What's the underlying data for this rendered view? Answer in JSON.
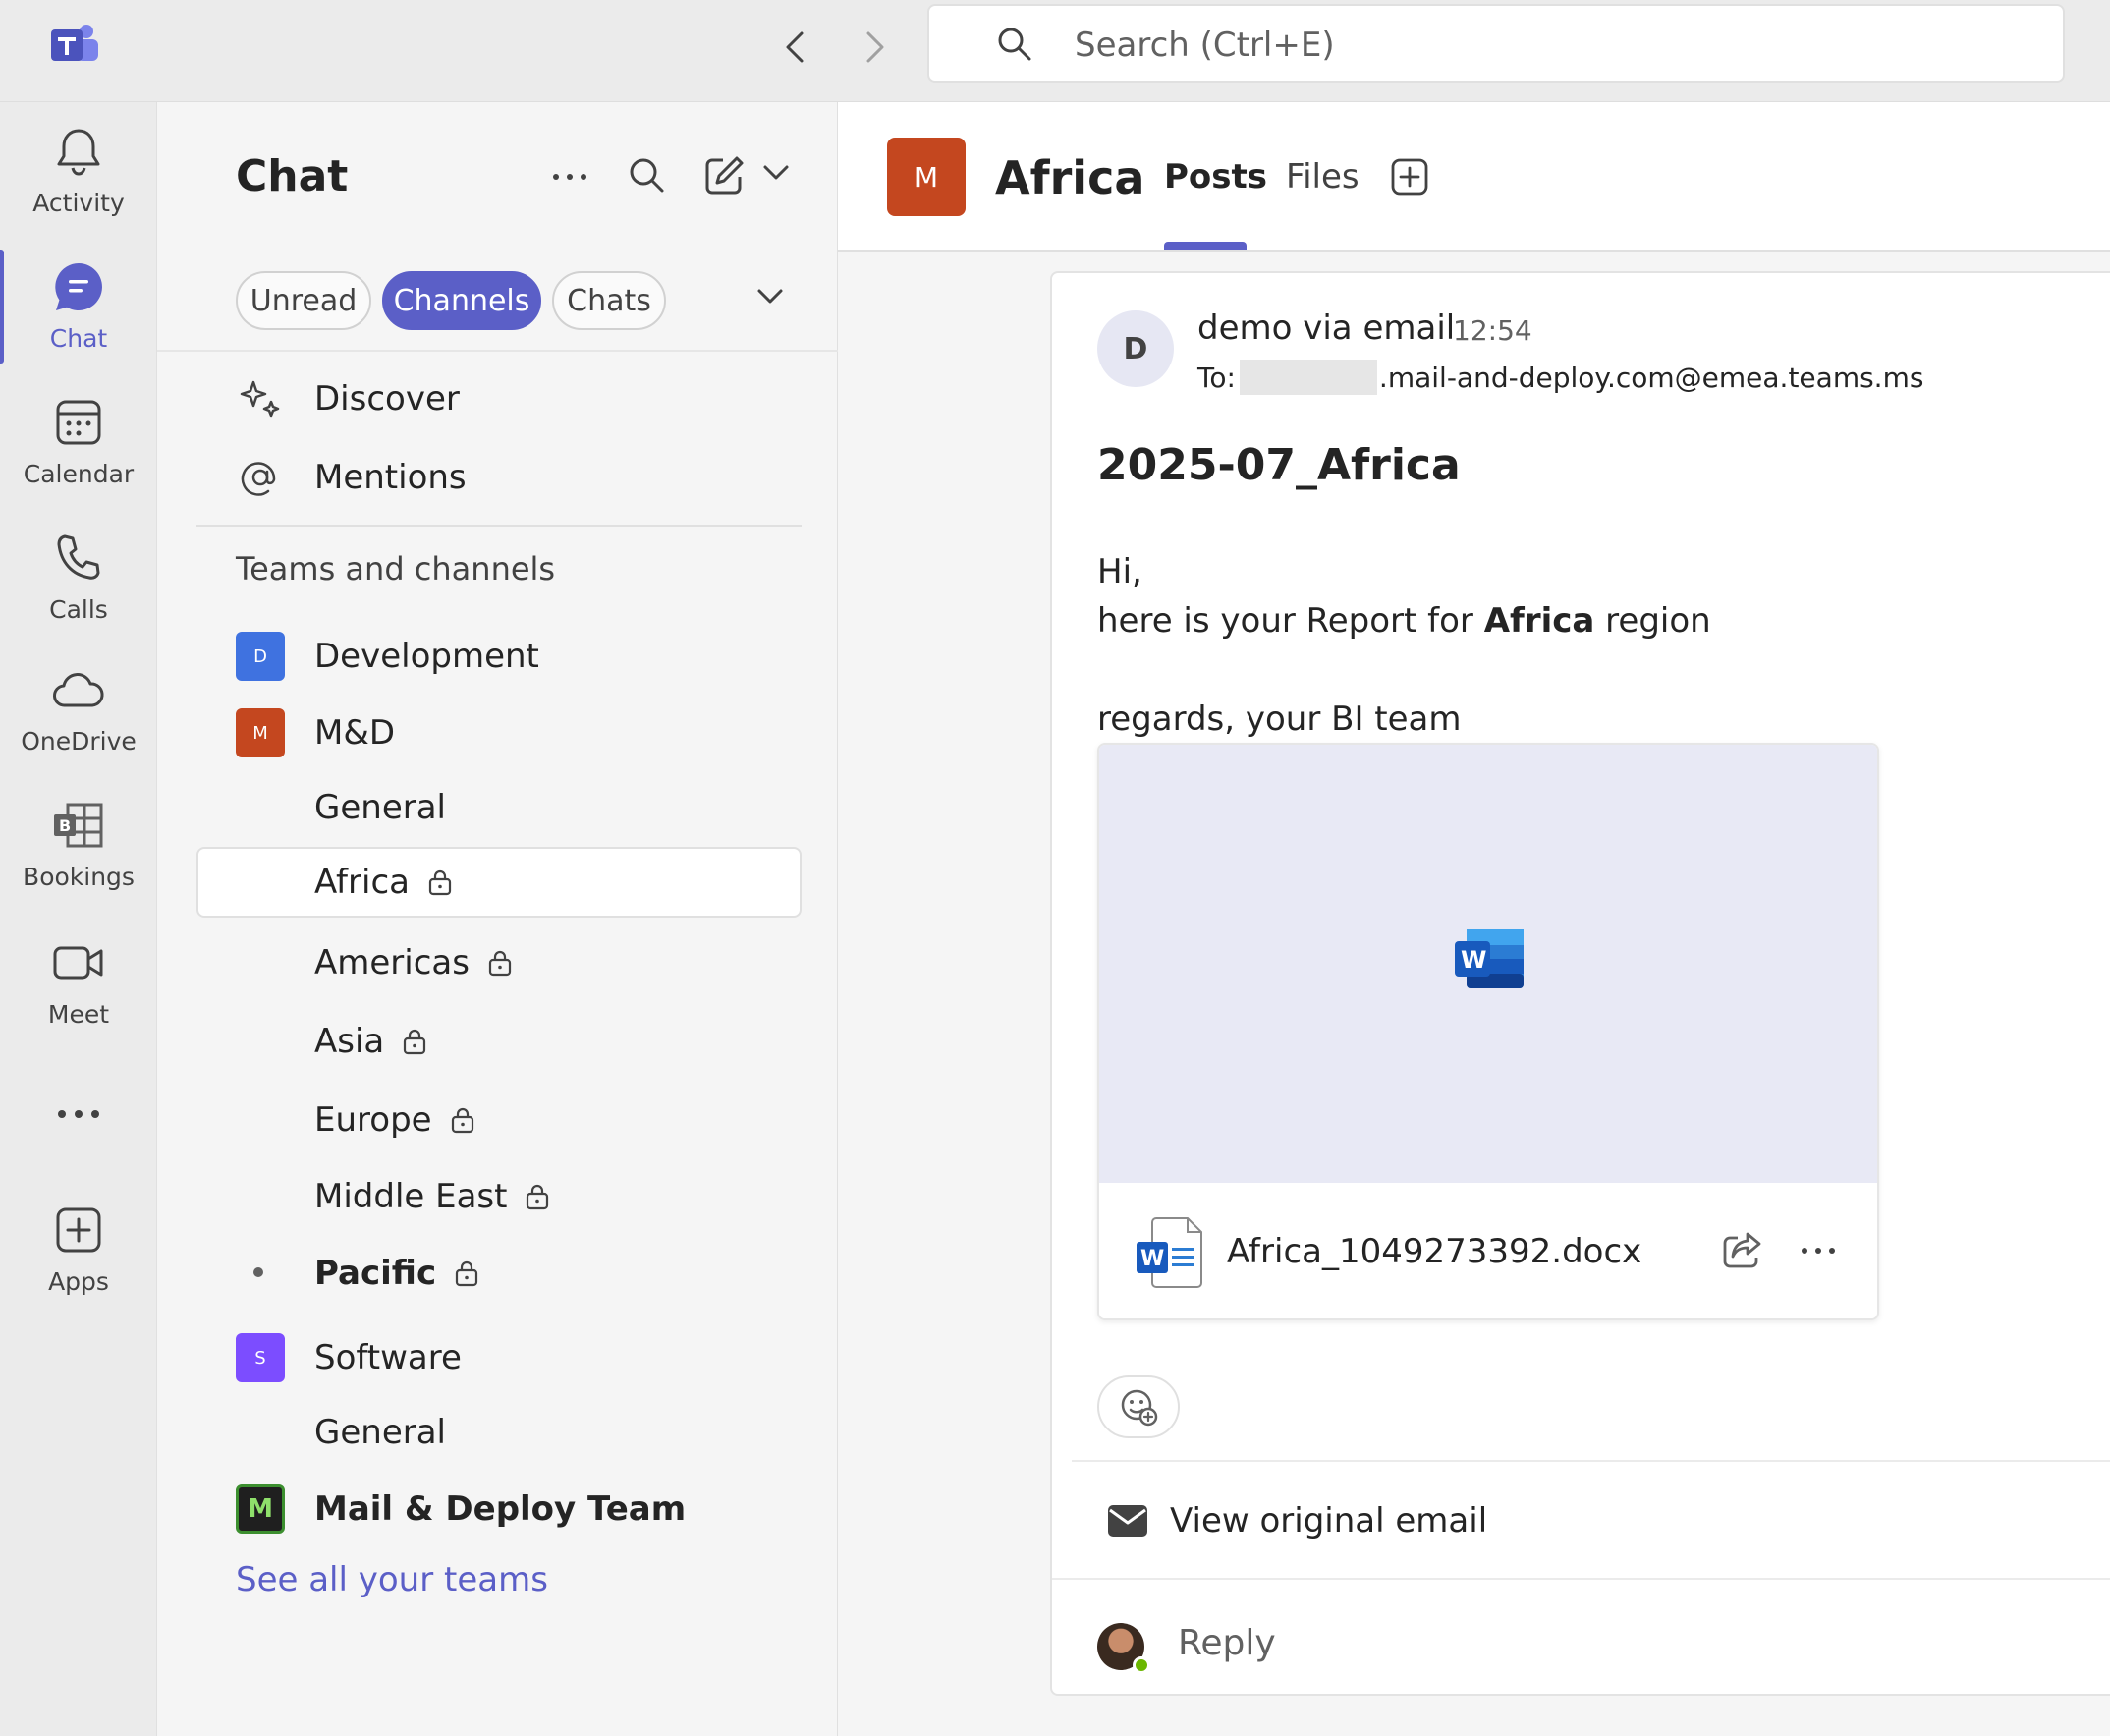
{
  "topbar": {
    "search_placeholder": "Search (Ctrl+E)"
  },
  "rail": {
    "items": [
      {
        "label": "Activity",
        "icon": "bell-icon"
      },
      {
        "label": "Chat",
        "icon": "chat-icon",
        "active": true
      },
      {
        "label": "Calendar",
        "icon": "calendar-icon"
      },
      {
        "label": "Calls",
        "icon": "phone-icon"
      },
      {
        "label": "OneDrive",
        "icon": "cloud-icon"
      },
      {
        "label": "Bookings",
        "icon": "bookings-icon"
      },
      {
        "label": "Meet",
        "icon": "video-icon"
      },
      {
        "label": "",
        "icon": "more-horizontal-icon"
      },
      {
        "label": "Apps",
        "icon": "apps-add-icon"
      }
    ]
  },
  "list": {
    "title": "Chat",
    "filters": [
      {
        "label": "Unread",
        "active": false
      },
      {
        "label": "Channels",
        "active": true
      },
      {
        "label": "Chats",
        "active": false
      }
    ],
    "quick_links": [
      {
        "label": "Discover",
        "icon": "sparkle-icon"
      },
      {
        "label": "Mentions",
        "icon": "at-icon"
      }
    ],
    "section_header": "Teams and channels",
    "teams": [
      {
        "name": "Development",
        "initial": "D",
        "color": "#3f72e0"
      },
      {
        "name": "M&D",
        "initial": "M",
        "color": "#c4471f"
      },
      {
        "name": "Software",
        "initial": "S",
        "color": "#7c4dff"
      },
      {
        "name": "Mail & Deploy Team",
        "initial": "M",
        "color": "#3c8f2f"
      }
    ],
    "channels": {
      "md_general": "General",
      "africa": "Africa",
      "americas": "Americas",
      "asia": "Asia",
      "europe": "Europe",
      "middle_east": "Middle East",
      "pacific": "Pacific",
      "software_general": "General"
    },
    "see_all": "See all your teams"
  },
  "channel": {
    "avatar_initial": "M",
    "avatar_color": "#c4471f",
    "title": "Africa",
    "tabs": [
      {
        "label": "Posts",
        "active": true
      },
      {
        "label": "Files",
        "active": false
      }
    ]
  },
  "post": {
    "sender_initial": "D",
    "sender": "demo via email",
    "time": "12:54",
    "to_prefix": "To:",
    "to_address": ".mail-and-deploy.com@emea.teams.ms",
    "subject": "2025-07_Africa",
    "body": {
      "greeting": "Hi,",
      "line_before": "here is your Report for ",
      "line_bold": "Africa",
      "line_after": " region",
      "signoff": "regards, your BI team"
    },
    "attachment": {
      "file_name": "Africa_1049273392.docx",
      "type_icon": "word-icon"
    },
    "view_original": "View original email",
    "reply_label": "Reply"
  },
  "colors": {
    "accent": "#5b5fc7",
    "team_md": "#c4471f",
    "presence_available": "#6bb700"
  }
}
